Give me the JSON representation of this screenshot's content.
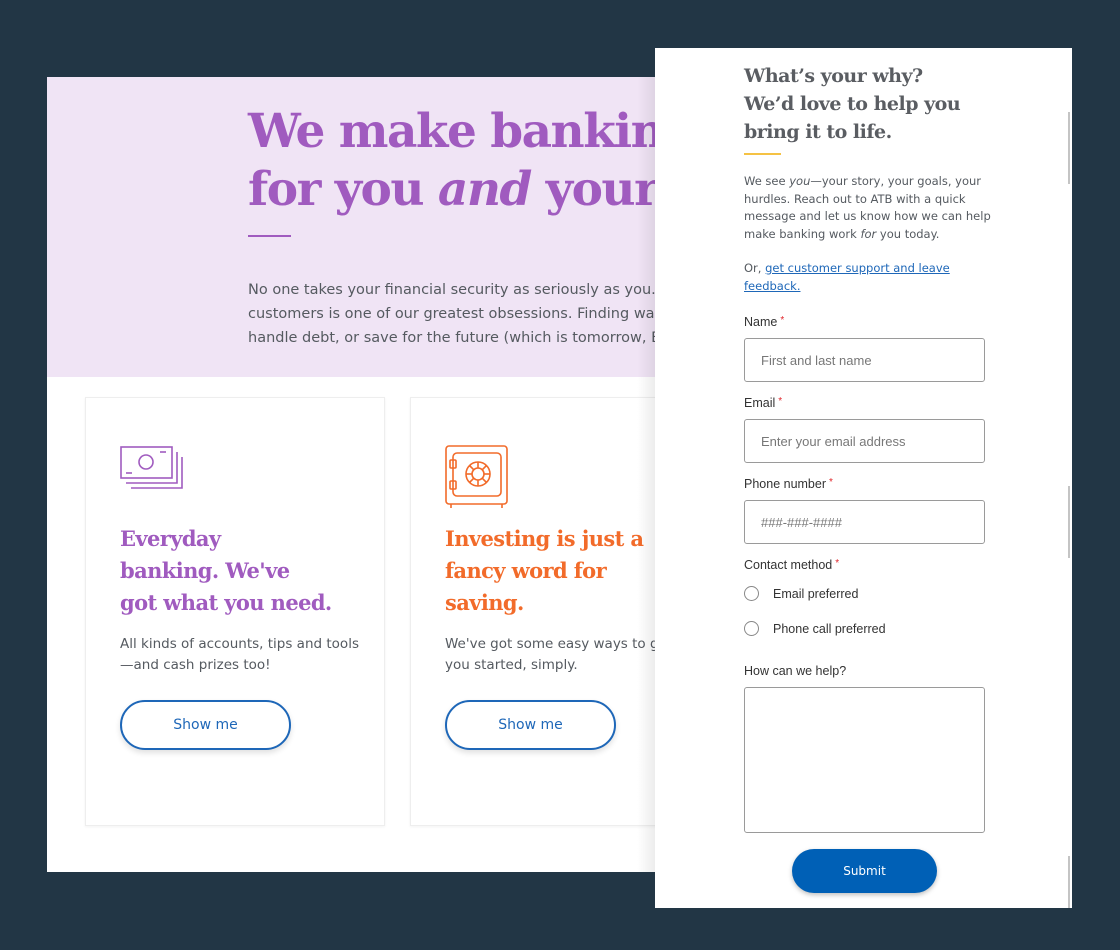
{
  "background_page": {
    "hero": {
      "title_line1": "We make bankin",
      "title_line2_pre": "for you ",
      "title_line2_em": "and",
      "title_line2_post": " your",
      "body_lines": [
        "No one takes your financial security as seriously as you. T",
        "customers is one of our greatest obsessions. Finding way",
        "handle debt, or save for the future (which is tomorrow, B"
      ],
      "accent_color": "#a05bbf",
      "background_color": "#f0e4f5"
    },
    "cards": [
      {
        "icon": "money-stack-icon",
        "title_lines": [
          "Everyday",
          "banking. We've",
          "got what you need."
        ],
        "body_lines": [
          "All kinds of accounts, tips and tools",
          "—and cash prizes too!"
        ],
        "button_label": "Show me",
        "accent_color": "#a05bbf"
      },
      {
        "icon": "safe-icon",
        "title_lines": [
          "Investing is just a",
          "fancy word for",
          "saving."
        ],
        "body_lines": [
          "We've got some easy ways to get",
          "you started, simply."
        ],
        "button_label": "Show me",
        "accent_color": "#f26b2a"
      }
    ]
  },
  "contact_form": {
    "title_lines": [
      "What’s your why?",
      "We’d love to help you",
      "bring it to life."
    ],
    "intro": {
      "line1_pre": "We see ",
      "line1_em": "you",
      "line1_post": "—your story, your goals, your",
      "line2": "hurdles. Reach out to ATB with a quick",
      "line3": "message and let us know how we can help",
      "line4_pre": "make banking work ",
      "line4_em": "for",
      "line4_post": " you today."
    },
    "support": {
      "prefix": "Or, ",
      "link_line1": "get customer support and leave",
      "link_line2": "feedback."
    },
    "fields": {
      "name": {
        "label": "Name",
        "required_marker": "*",
        "value": "",
        "placeholder": "First and last name"
      },
      "email": {
        "label": "Email",
        "required_marker": "*",
        "value": "",
        "placeholder": "Enter your email address"
      },
      "phone": {
        "label": "Phone number",
        "required_marker": "*",
        "value": "",
        "placeholder": "###-###-####"
      }
    },
    "contact_method": {
      "label": "Contact method",
      "required_marker": "*",
      "options": [
        {
          "label": "Email preferred",
          "selected": false
        },
        {
          "label": "Phone call preferred",
          "selected": false
        }
      ]
    },
    "help": {
      "label": "How can we help?",
      "value": ""
    },
    "submit_label": "Submit",
    "colors": {
      "primary": "#0060b6",
      "rule": "#f5c244",
      "required": "#e0262b",
      "link": "#1e67b8"
    }
  }
}
